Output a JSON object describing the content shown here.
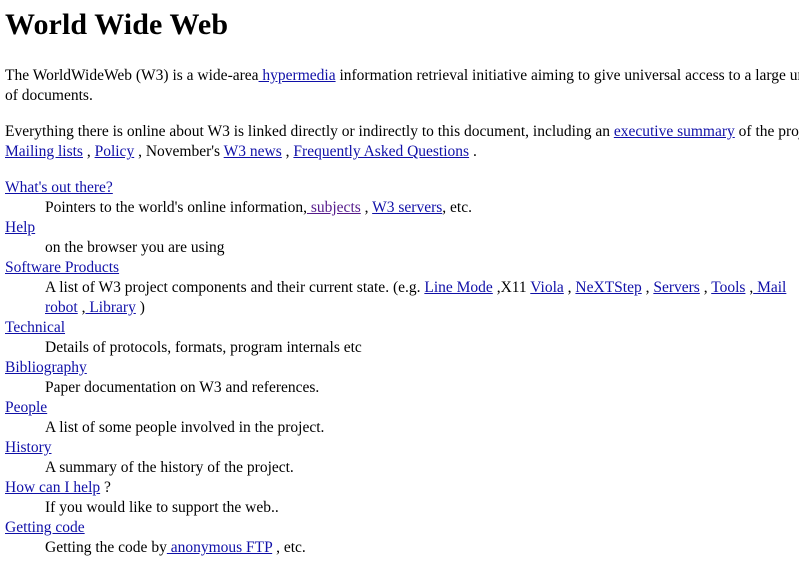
{
  "page": {
    "title": "World Wide Web",
    "colors": {
      "link": "#1010a8",
      "visited_link": "#551a8b",
      "text": "#000000",
      "background": "#ffffff"
    }
  },
  "intro": {
    "line1_before": "The WorldWideWeb (W3) is a wide-area",
    "hypermedia_link": " hypermedia",
    "line1_after": " information retrieval initiative aiming to give universal access to a large univers",
    "line2": "of documents."
  },
  "everything": {
    "text_before": "Everything there is online about W3 is linked directly or indirectly to this document, including an ",
    "exec_summary_link": "executive summary",
    "text_after_exec": " of the project,",
    "mailing_lists_link": "Mailing lists",
    "sep1": " , ",
    "policy_link": "Policy",
    "sep2": " , November's ",
    "w3_news_link": "W3 news",
    "sep3": " , ",
    "faq_link": "Frequently Asked Questions",
    "end": " ."
  },
  "sections": [
    {
      "term": "What's out there?",
      "desc_before": "Pointers to the world's online information,",
      "links": [
        {
          "label": " subjects",
          "visited": true
        },
        {
          "sep": " , "
        },
        {
          "label": " W3 servers"
        }
      ],
      "desc_after": ", etc."
    },
    {
      "term": "Help",
      "desc": "on the browser you are using"
    },
    {
      "term": "Software Products",
      "desc_before": "A list of W3 project components and their current state. (e.g. ",
      "line_mode": "Line Mode",
      "x11_text": " ,X11 ",
      "viola": "Viola",
      "nextstep": "NeXTStep",
      "servers": "Servers",
      "tools": "Tools",
      "mail_robot": " Mail robot",
      "library": " Library",
      "sep": " , ",
      "close": " )"
    },
    {
      "term": "Technical",
      "desc": "Details of protocols, formats, program internals etc"
    },
    {
      "term": "Bibliography",
      "desc": "Paper documentation on W3 and references."
    },
    {
      "term": "People",
      "desc": "A list of some people involved in the project."
    },
    {
      "term": "History",
      "desc": "A summary of the history of the project."
    },
    {
      "term": "How can I help",
      "term_suffix": " ?",
      "desc": "If you would like to support the web.."
    },
    {
      "term": "Getting code",
      "desc_before": "Getting the code by",
      "ftp_link": " anonymous FTP",
      "desc_after": " , etc."
    }
  ]
}
